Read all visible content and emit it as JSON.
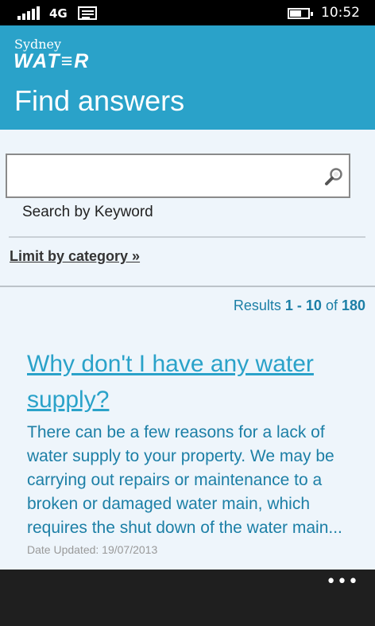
{
  "status_bar": {
    "network": "4G",
    "time": "10:52",
    "icons": [
      "signal-icon",
      "message-icon",
      "battery-icon"
    ]
  },
  "header": {
    "logo_top": "Sydney",
    "logo_main": "WAT≡R",
    "title": "Find answers",
    "bg_color": "#2aa2c9"
  },
  "search": {
    "value": "",
    "placeholder": "",
    "hint": "Search by Keyword",
    "button_icon": "search-icon"
  },
  "filter": {
    "label": "Limit by category »"
  },
  "results": {
    "prefix": "Results ",
    "range": "1 - 10",
    "of": " of ",
    "total": "180"
  },
  "items": [
    {
      "title": "Why don't I have any water supply?",
      "snippet": "There can be a few reasons for a lack of water supply to your property. We may be carrying out repairs or maintenance to a broken or damaged water main, which requires the shut down of the water main...",
      "date": "Date Updated: 19/07/2013"
    }
  ],
  "app_bar": {
    "more_label": "•••"
  }
}
